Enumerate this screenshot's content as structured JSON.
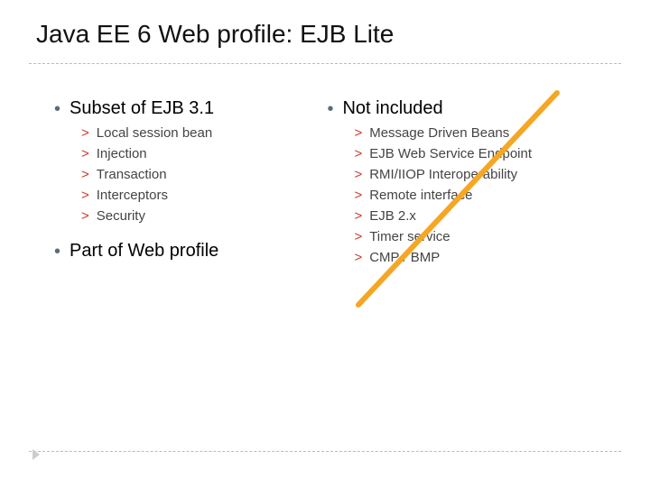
{
  "title": "Java EE 6 Web profile: EJB Lite",
  "left": {
    "heading1": "Subset of  EJB 3.1",
    "items1": [
      "Local session bean",
      "Injection",
      "Transaction",
      "Interceptors",
      "Security"
    ],
    "heading2": "Part of Web profile"
  },
  "right": {
    "heading": "Not included",
    "items": [
      "Message Driven Beans",
      "EJB Web Service Endpoint",
      "RMI/IIOP Interoperability",
      "Remote interface",
      "EJB 2.x",
      "Timer service",
      "CMP / BMP"
    ]
  },
  "bullet_glyph": "•",
  "sub_glyph": ">"
}
